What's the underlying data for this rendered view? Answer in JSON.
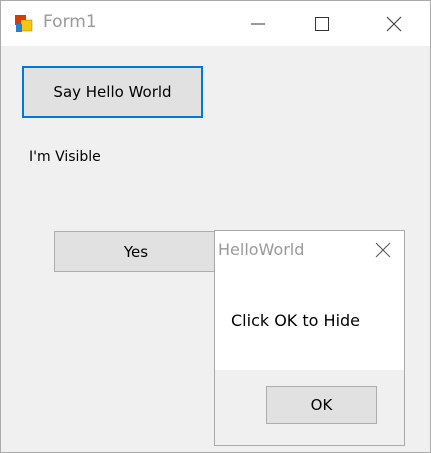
{
  "window": {
    "title": "Form1"
  },
  "form": {
    "say_hello_label": "Say Hello World",
    "status_label": "I'm Visible",
    "yes_label": "Yes"
  },
  "dialog": {
    "title": "HelloWorld",
    "message": "Click OK to Hide",
    "ok_label": "OK"
  }
}
